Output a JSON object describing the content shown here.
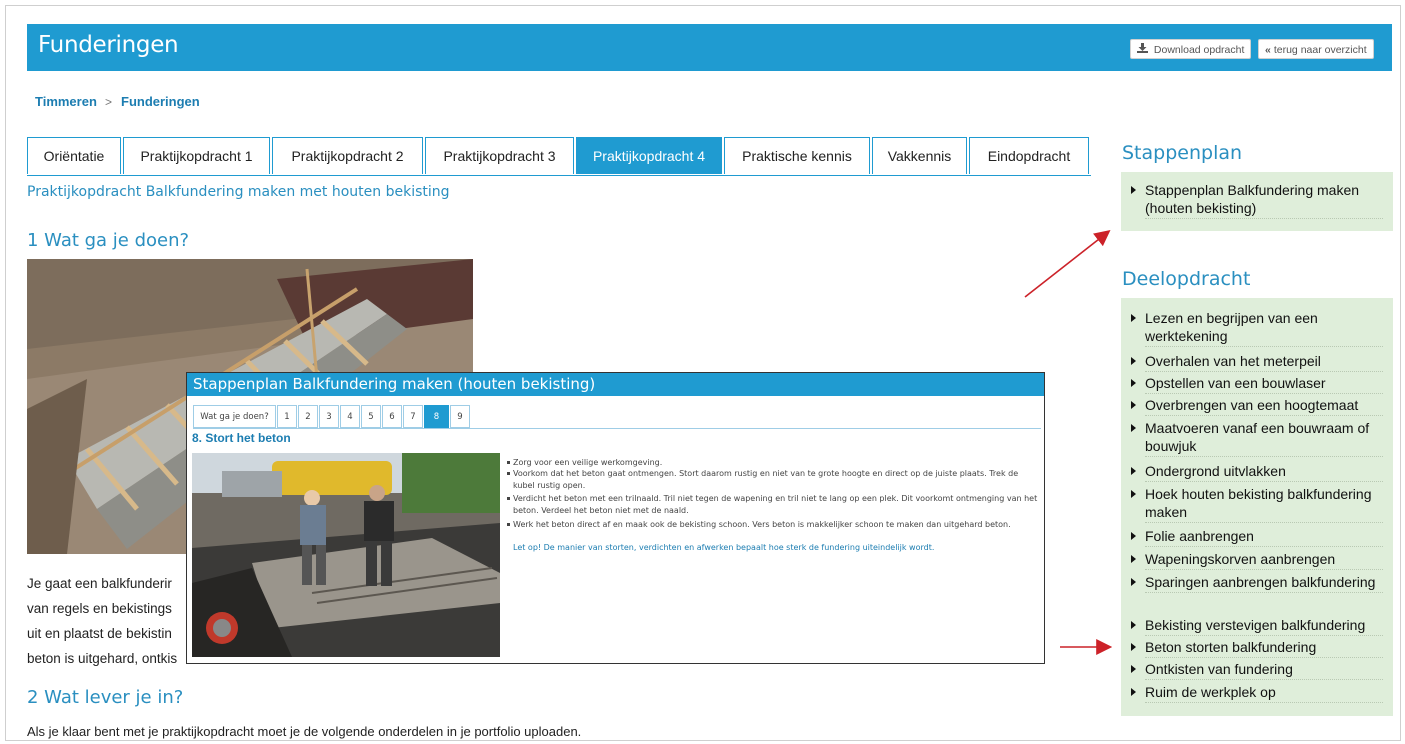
{
  "header": {
    "title": "Funderingen",
    "download_label": "Download opdracht",
    "back_label": "terug naar overzicht"
  },
  "breadcrumb": {
    "items": [
      "Timmeren",
      "Funderingen"
    ],
    "separator": ">"
  },
  "tabs": [
    {
      "label": "Oriëntatie"
    },
    {
      "label": "Praktijkopdracht 1"
    },
    {
      "label": "Praktijkopdracht 2"
    },
    {
      "label": "Praktijkopdracht 3"
    },
    {
      "label": "Praktijkopdracht 4",
      "active": true
    },
    {
      "label": "Praktische kennis"
    },
    {
      "label": "Vakkennis"
    },
    {
      "label": "Eindopdracht"
    }
  ],
  "main": {
    "subtitle": "Praktijkopdracht Balkfundering maken met houten bekisting",
    "section1_title": "1   Wat ga je doen?",
    "section1_lines": [
      "Je gaat een balkfunderir",
      "van regels en bekistings",
      "uit en plaatst de bekistin",
      "beton is uitgehard, ontkis"
    ],
    "section2_title": "2   Wat lever je in?",
    "section2_text": "Als je klaar bent met je praktijkopdracht moet je de volgende onderdelen in je portfolio uploaden."
  },
  "sidebar": {
    "stappenplan_title": "Stappenplan",
    "stappenplan_items": [
      "Stappenplan Balkfundering maken (houten bekisting)"
    ],
    "deelopdracht_title": "Deelopdracht",
    "deelopdracht_items": [
      "Lezen en begrijpen van een werktekening",
      "Overhalen van het meterpeil",
      "Opstellen van een bouwlaser",
      "Overbrengen van een hoogtemaat",
      "Maatvoeren vanaf een bouwraam of bouwjuk",
      "Ondergrond uitvlakken",
      "Hoek houten bekisting balkfundering maken",
      "Folie aanbrengen",
      "Wapeningskorven aanbrengen",
      "Sparingen aanbrengen balkfundering",
      "Bekisting verstevigen balkfundering",
      "Beton storten balkfundering",
      "Ontkisten van fundering",
      "Ruim de werkplek op"
    ]
  },
  "popup": {
    "title": "Stappenplan Balkfundering maken (houten bekisting)",
    "tabs": [
      "Wat ga je doen?",
      "1",
      "2",
      "3",
      "4",
      "5",
      "6",
      "7",
      "8",
      "9"
    ],
    "active_tab": "8",
    "heading": "8. Stort het beton",
    "bullets": [
      "Zorg voor een veilige werkomgeving.",
      "Voorkom dat het beton gaat ontmengen. Stort daarom rustig en niet van te grote hoogte en direct op de juiste plaats. Trek de kubel rustig open.",
      "Verdicht het beton met een trilnaald. Tril niet tegen de wapening en tril niet te lang op een plek. Dit voorkomt ontmenging van het beton. Verdeel het beton niet met de naald.",
      "Werk het beton direct af en maak ook de bekisting schoon. Vers beton is makkelijker schoon te maken dan uitgehard beton."
    ],
    "note": "Let op! De manier van storten, verdichten en afwerken bepaalt hoe sterk de fundering uiteindelijk wordt."
  },
  "colors": {
    "brand": "#1f9bd1",
    "sidebar_bg": "#dfeeda",
    "annotation_arrow": "#cc2229"
  },
  "icons": {
    "download": "download-icon",
    "back": "double-chevron-left-icon",
    "list_marker": "triangle-right-icon"
  }
}
